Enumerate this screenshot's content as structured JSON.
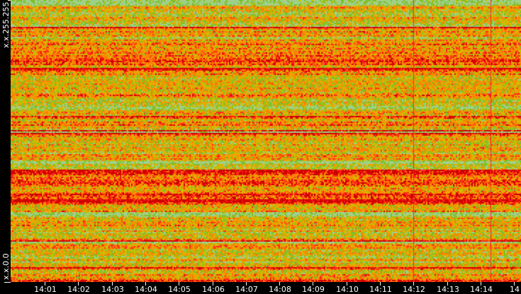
{
  "chart_data": {
    "type": "heatmap",
    "title": "",
    "xlabel": "",
    "ylabel": "",
    "x_ticks": [
      "14:01",
      "14:02",
      "14:03",
      "14:04",
      "14:05",
      "14:06",
      "14:07",
      "14:08",
      "14:09",
      "14:10",
      "14:11",
      "14:12",
      "14:13",
      "14:14",
      "14"
    ],
    "y_labels": {
      "top": "x.x.255.255",
      "bottom": "x.x.0.0"
    },
    "color_scale": [
      "#9fd08a",
      "#7fbf2a",
      "#c8c000",
      "#f0a000",
      "#ff7a00",
      "#ff2a1a",
      "#d00000"
    ],
    "vertical_markers": [
      "14:12",
      "14:14"
    ],
    "marker_color": "#ff2020"
  }
}
